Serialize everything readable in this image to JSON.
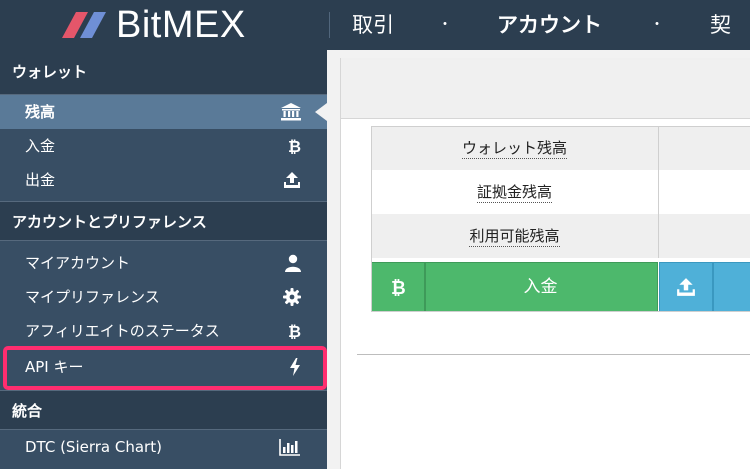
{
  "header": {
    "brand": "BitMEX",
    "nav": [
      {
        "label": "取引"
      },
      {
        "label": "アカウント"
      },
      {
        "label": "契約"
      }
    ],
    "separator": "・"
  },
  "sidebar": {
    "sections": [
      {
        "title": "ウォレット",
        "items": [
          {
            "label": "残高",
            "icon": "bank-icon",
            "active": true
          },
          {
            "label": "入金",
            "icon": "bitcoin-icon"
          },
          {
            "label": "出金",
            "icon": "upload-tray-icon"
          }
        ]
      },
      {
        "title": "アカウントとプリファレンス",
        "items": [
          {
            "label": "マイアカウント",
            "icon": "user-icon"
          },
          {
            "label": "マイプリファレンス",
            "icon": "gear-icon"
          },
          {
            "label": "アフィリエイトのステータス",
            "icon": "bitcoin-icon"
          },
          {
            "label": "API キー",
            "icon": "lightning-icon",
            "highlighted": true
          }
        ]
      },
      {
        "title": "統合",
        "items": [
          {
            "label": "DTC (Sierra Chart)",
            "icon": "bar-chart-icon"
          }
        ]
      }
    ]
  },
  "main": {
    "balances": [
      {
        "label": "ウォレット残高"
      },
      {
        "label": "証拠金残高"
      },
      {
        "label": "利用可能残高"
      }
    ],
    "deposit_label": "入金"
  },
  "colors": {
    "topbar": "#2c3e50",
    "sidebar": "#384e64",
    "active_item": "#5a7a98",
    "highlight": "#ff2d6f",
    "deposit": "#4db86c",
    "withdraw": "#4fb0d8"
  }
}
